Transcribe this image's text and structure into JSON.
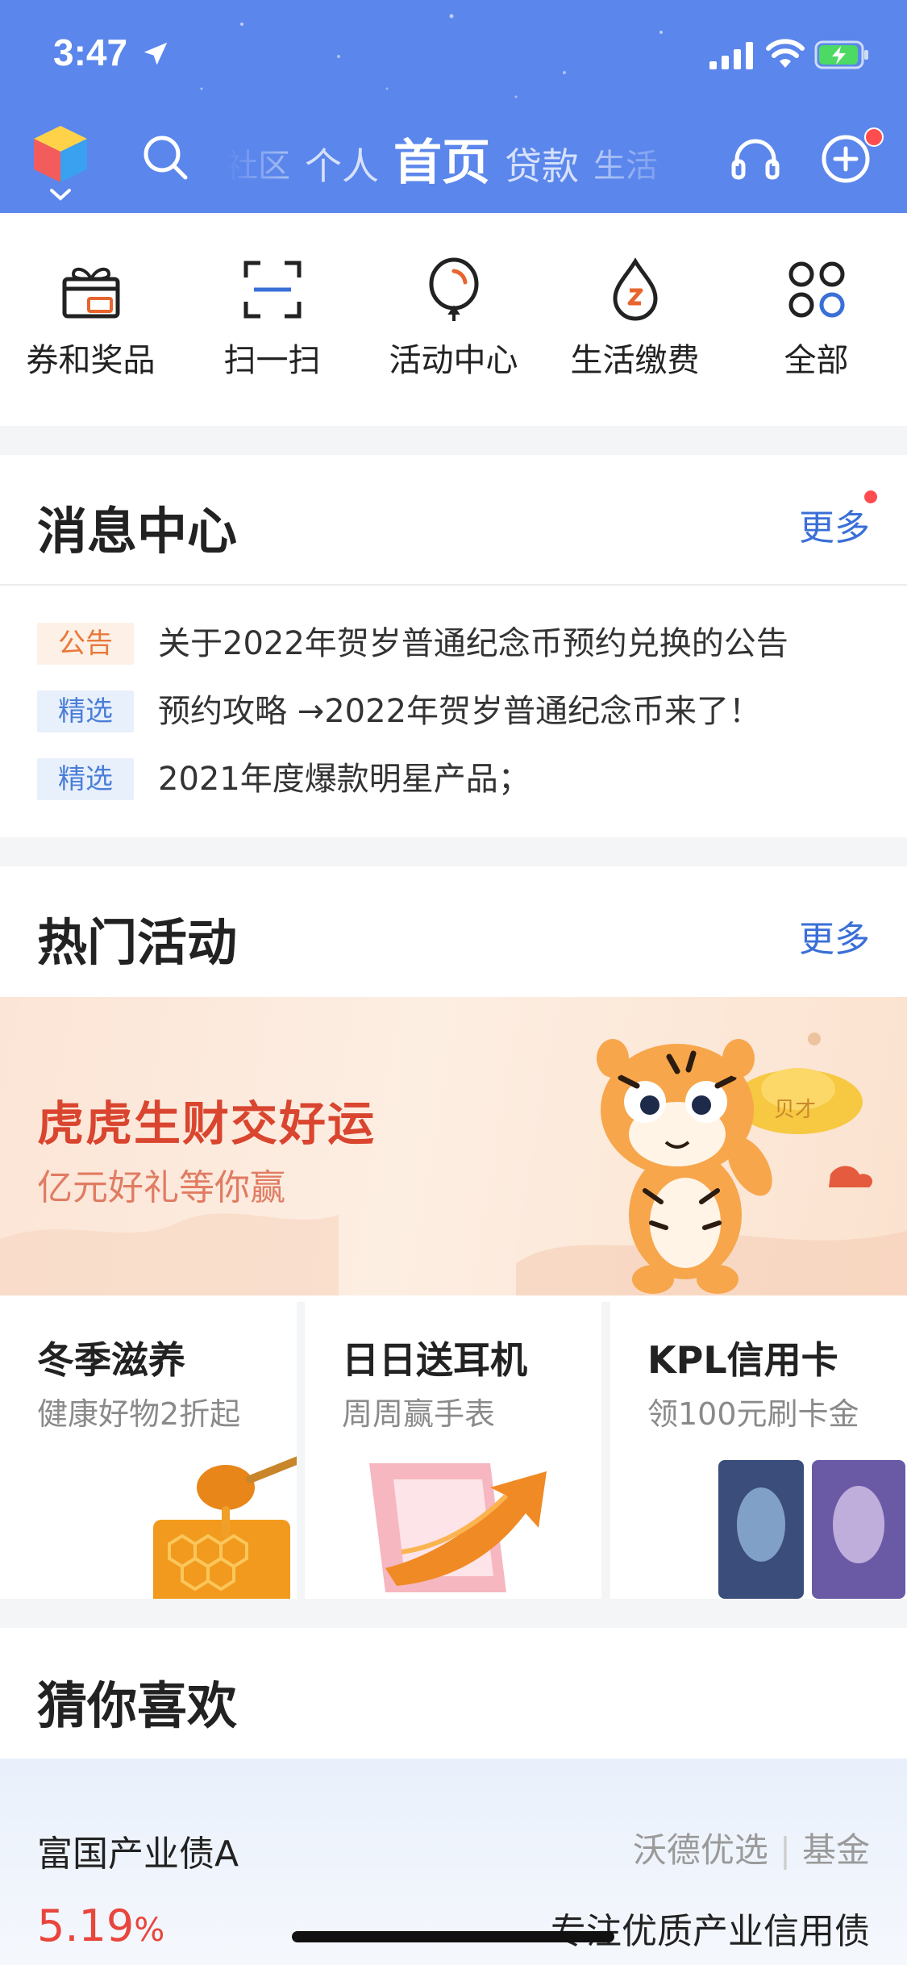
{
  "status": {
    "time": "3:47"
  },
  "nav": {
    "tabs": [
      {
        "label": "社区",
        "style": "small"
      },
      {
        "label": "个人",
        "style": "normal"
      },
      {
        "label": "首页",
        "style": "active"
      },
      {
        "label": "贷款",
        "style": "normal"
      },
      {
        "label": "生活",
        "style": "small"
      }
    ]
  },
  "quick_actions": [
    {
      "label": "券和奖品",
      "icon": "gift-coupon-icon"
    },
    {
      "label": "扫一扫",
      "icon": "scan-icon"
    },
    {
      "label": "活动中心",
      "icon": "balloon-icon"
    },
    {
      "label": "生活缴费",
      "icon": "bill-drop-icon"
    },
    {
      "label": "全部",
      "icon": "grid-icon"
    }
  ],
  "message_center": {
    "title": "消息中心",
    "more": "更多",
    "items": [
      {
        "tag": "公告",
        "text": "关于2022年贺岁普通纪念币预约兑换的公告"
      },
      {
        "tag": "精选",
        "text": "预约攻略 →2022年贺岁普通纪念币来了！"
      },
      {
        "tag": "精选",
        "text": "2021年度爆款明星产品；"
      }
    ]
  },
  "hot_activities": {
    "title": "热门活动",
    "more": "更多",
    "banner": {
      "title": "虎虎生财交好运",
      "subtitle": "亿元好礼等你赢",
      "ingot_text": "贝才"
    },
    "promos": [
      {
        "title": "冬季滋养",
        "subtitle": "健康好物2折起"
      },
      {
        "title": "日日送耳机",
        "subtitle": "周周赢手表"
      },
      {
        "title": "KPL信用卡",
        "subtitle": "领100元刷卡金"
      }
    ]
  },
  "guess": {
    "title": "猜你喜欢",
    "fund": {
      "name": "富国产业债A",
      "tag1": "沃德优选",
      "tag2": "基金",
      "rate": "5.19",
      "rate_unit": "%",
      "desc": "专注优质产业信用债"
    }
  },
  "colors": {
    "header": "#5b86ec",
    "accent": "#3a6fd8",
    "rate": "#e8453c",
    "notice": "#e8793a"
  }
}
